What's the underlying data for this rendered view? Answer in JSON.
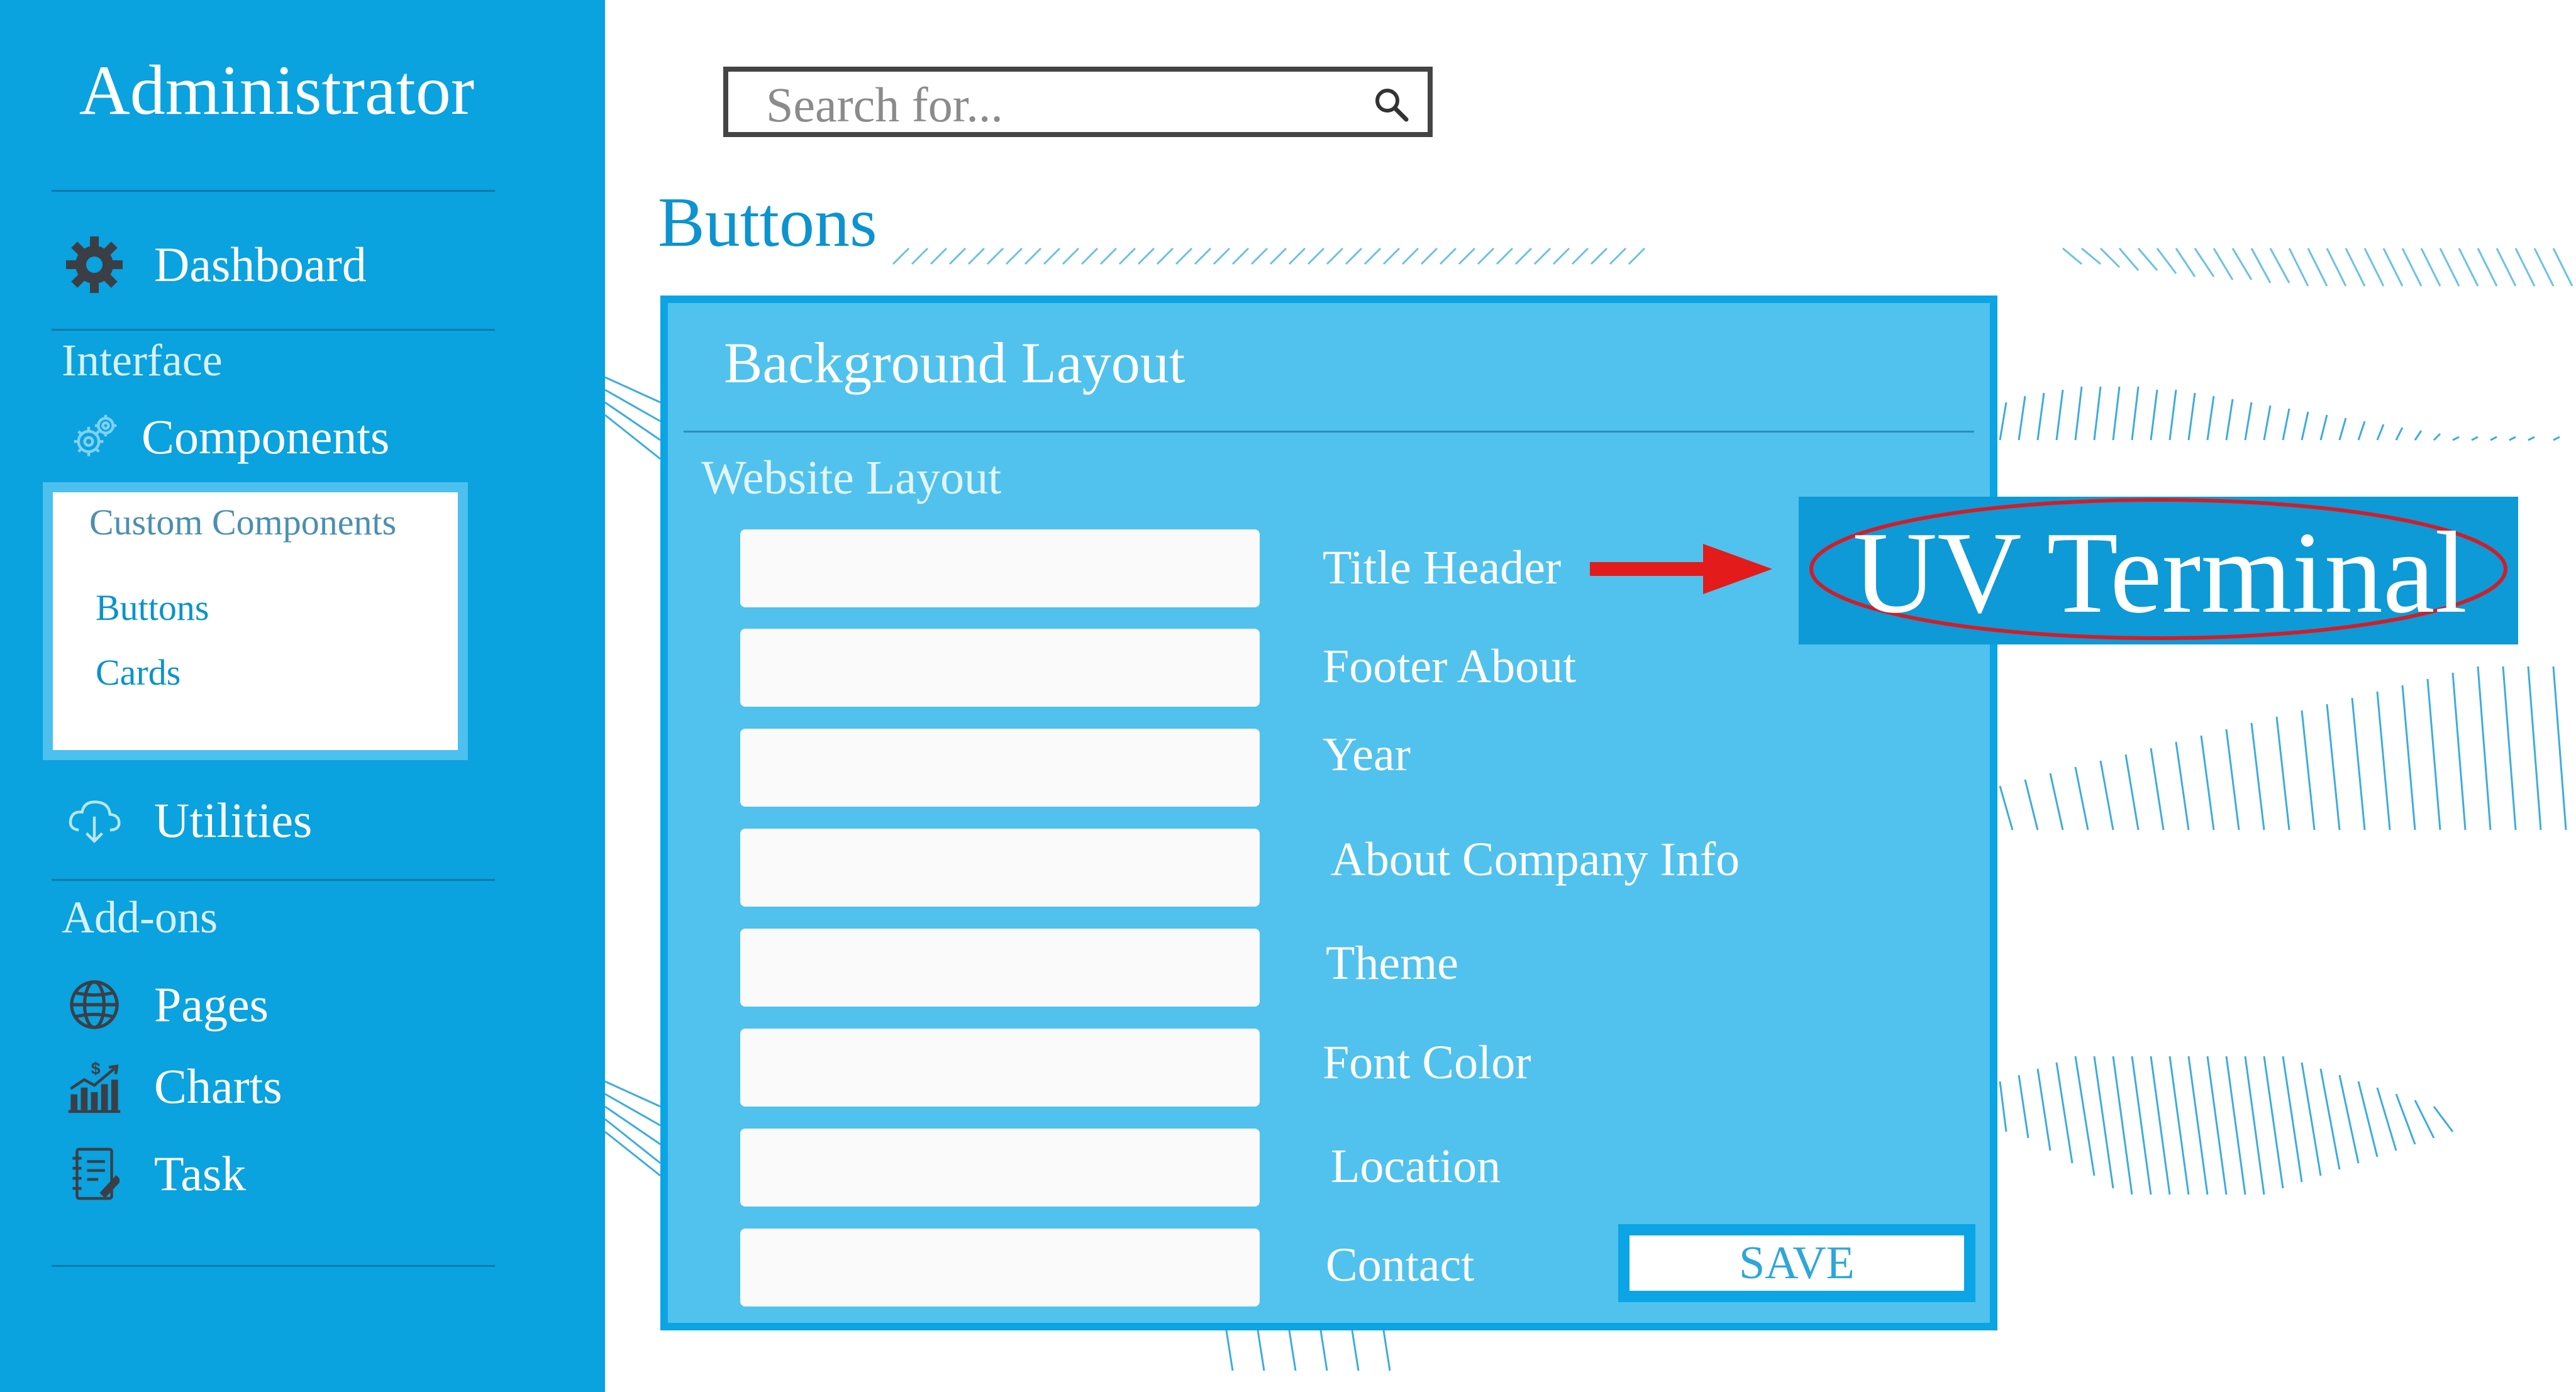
{
  "sidebar": {
    "brand": "Administrator",
    "dashboard": {
      "label": "Dashboard",
      "icon": "gear-icon"
    },
    "section_interface": "Interface",
    "components": {
      "label": "Components",
      "icon": "gears-icon"
    },
    "custom_components": {
      "title": "Custom Components",
      "links": [
        "Buttons",
        "Cards"
      ]
    },
    "utilities": {
      "label": "Utilities",
      "icon": "cloud-download-icon"
    },
    "section_addons": "Add-ons",
    "pages": {
      "label": "Pages",
      "icon": "globe-icon"
    },
    "charts": {
      "label": "Charts",
      "icon": "chart-icon"
    },
    "task": {
      "label": "Task",
      "icon": "notebook-icon"
    }
  },
  "search": {
    "placeholder": "Search for...",
    "icon": "search-icon"
  },
  "page_title": "Buttons",
  "card": {
    "title": "Background Layout",
    "subtitle": "Website Layout",
    "fields": [
      {
        "label": "Title Header",
        "value": ""
      },
      {
        "label": "Footer About",
        "value": ""
      },
      {
        "label": "Year",
        "value": ""
      },
      {
        "label": "About Company Info",
        "value": ""
      },
      {
        "label": "Theme",
        "value": ""
      },
      {
        "label": "Font Color",
        "value": ""
      },
      {
        "label": "Location",
        "value": ""
      },
      {
        "label": "Contact",
        "value": ""
      }
    ],
    "save_label": "SAVE"
  },
  "preview": {
    "brand_text": "UV Terminal"
  },
  "colors": {
    "sidebar": "#0aa2df",
    "card": "#50c2ed",
    "card_border": "#0ba4e4",
    "accent_title": "#0d93cf",
    "annotation_red": "#e31b1b"
  }
}
